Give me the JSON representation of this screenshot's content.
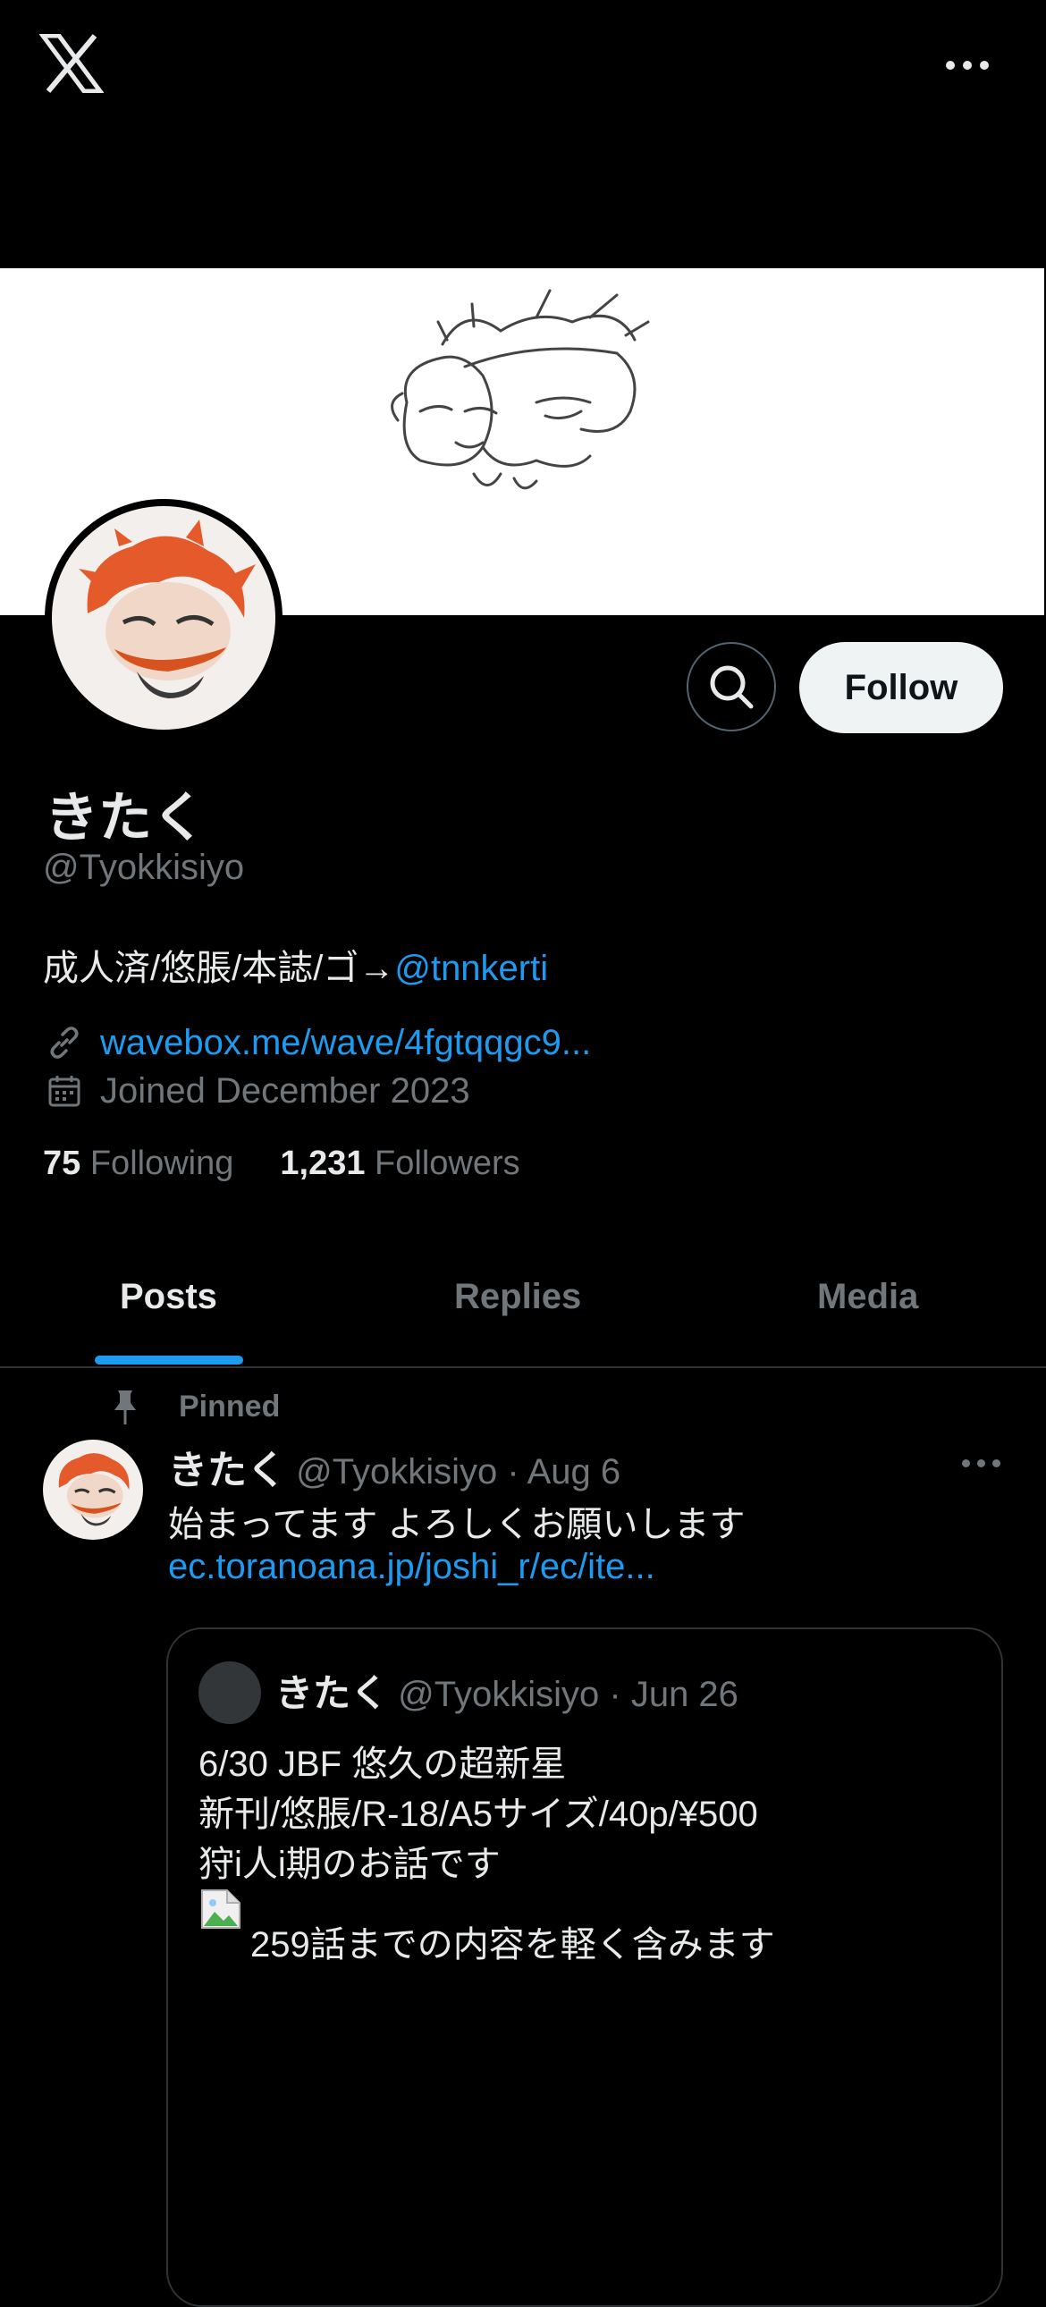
{
  "header": {
    "logo_icon": "x-logo-icon",
    "more_icon": "more-horizontal-icon"
  },
  "profile": {
    "display_name": "きたく",
    "handle": "@Tyokkisiyo",
    "bio_text": "成人済/悠脹/本誌/ゴ→",
    "bio_mention": "@tnnkerti",
    "link_icon": "link-icon",
    "website": "wavebox.me/wave/4fgtqqgc9...",
    "calendar_icon": "calendar-icon",
    "joined": "Joined December 2023",
    "following_count": "75",
    "following_label": "Following",
    "followers_count": "1,231",
    "followers_label": "Followers"
  },
  "actions": {
    "search_icon": "search-icon",
    "follow_label": "Follow"
  },
  "tabs": [
    {
      "label": "Posts",
      "active": true
    },
    {
      "label": "Replies",
      "active": false
    },
    {
      "label": "Media",
      "active": false
    }
  ],
  "pinned_post": {
    "pinned_label": "Pinned",
    "pin_icon": "pin-icon",
    "author_name": "きたく",
    "author_handle": "@Tyokkisiyo",
    "separator": "·",
    "date": "Aug 6",
    "text": "始まってます よろしくお願いします",
    "link": "ec.toranoana.jp/joshi_r/ec/ite...",
    "quote": {
      "author_name": "きたく",
      "author_handle": "@Tyokkisiyo",
      "separator": "·",
      "date": "Jun 26",
      "lines": [
        "6/30 JBF 悠久の超新星",
        "新刊/悠脹/R-18/A5サイズ/40p/¥500",
        "狩i人i期のお話です"
      ],
      "image_caption": "259話までの内容を軽く含みます"
    }
  },
  "colors": {
    "accent": "#1d9bf0",
    "background": "#000000",
    "muted": "#71767b",
    "text": "#e7e9ea"
  }
}
